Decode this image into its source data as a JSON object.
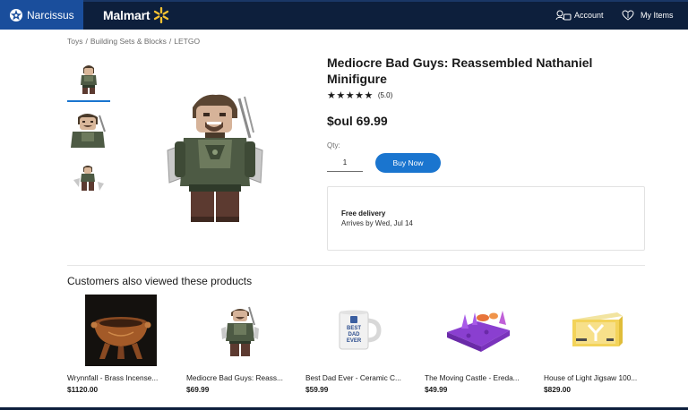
{
  "header": {
    "brand_name": "Narcissus",
    "store_name": "Malmart",
    "account_label": "Account",
    "items_label": "My Items",
    "colors": {
      "bar": "#0d1f3c",
      "brand_block": "#1a4e9c",
      "spark": "#f6c231"
    }
  },
  "breadcrumb": [
    "Toys",
    "Building Sets & Blocks",
    "LETGO"
  ],
  "gallery": {
    "thumbnails": [
      "minifigure-front",
      "minifigure-closeup",
      "minifigure-accessories"
    ],
    "selected_index": 0
  },
  "product": {
    "title": "Mediocre Bad Guys: Reassembled Nathaniel Minifigure",
    "stars": "★★★★★",
    "rating_value": 5.0,
    "rating_text": "(5.0)",
    "price": "$oul 69.99",
    "qty_label": "Qty:",
    "qty_value": "1",
    "buy_label": "Buy Now",
    "delivery_title": "Free delivery",
    "delivery_sub": "Arrives by Wed, Jul 14"
  },
  "also_viewed": {
    "title": "Customers also viewed these products",
    "items": [
      {
        "name": "Wrynnfall - Brass Incense...",
        "price": "$1120.00",
        "icon": "brass-incense-burner"
      },
      {
        "name": "Mediocre Bad Guys: Reass...",
        "price": "$69.99",
        "icon": "minifigure"
      },
      {
        "name": "Best Dad Ever - Ceramic C...",
        "price": "$59.99",
        "icon": "ceramic-mug",
        "mug_text": [
          "BEST",
          "DAD",
          "EVER"
        ]
      },
      {
        "name": "The Moving Castle - Ereda...",
        "price": "$49.99",
        "icon": "purple-castle-mold"
      },
      {
        "name": "House of Light Jigsaw 100...",
        "price": "$829.00",
        "icon": "jigsaw-box"
      }
    ]
  },
  "accent_color": "#1a75cf"
}
